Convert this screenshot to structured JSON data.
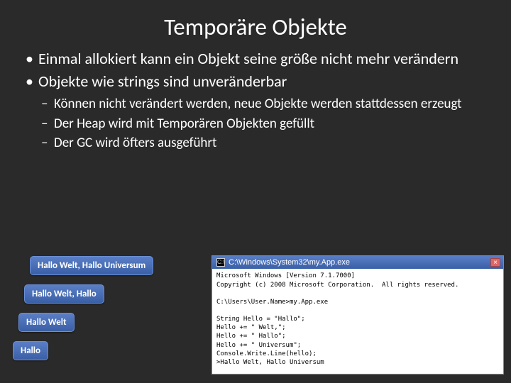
{
  "title": "Temporäre Objekte",
  "bullets": {
    "b1": "Einmal allokiert kann ein Objekt seine größe nicht mehr verändern",
    "b2": "Objekte wie strings sind unveränderbar",
    "sub1": "Können nicht verändert werden, neue Objekte werden stattdessen erzeugt",
    "sub2": "Der Heap wird mit Temporären Objekten gefüllt",
    "sub3": "Der GC wird öfters ausgeführt"
  },
  "pills": {
    "p1": "Hallo Welt, Hallo Universum",
    "p2": "Hallo Welt, Hallo",
    "p3": "Hallo Welt",
    "p4": "Hallo"
  },
  "console": {
    "titlebar": "C:\\Windows\\System32\\my.App.exe",
    "line1": "Microsoft Windows [Version 7.1.7000]",
    "line2": "Copyright (c) 2008 Microsoft Corporation.  All rights reserved.",
    "blank1": "",
    "line3": "C:\\Users\\User.Name>my.App.exe",
    "blank2": "",
    "line4": "String Hello = \"Hallo\";",
    "line5": "Hello += \" Welt,\";",
    "line6": "Hello += \" Hallo\";",
    "line7": "Hello += \" Universum\";",
    "line8": "Console.Write.Line(hello);",
    "line9": ">Hallo Welt, Hallo Universum"
  }
}
